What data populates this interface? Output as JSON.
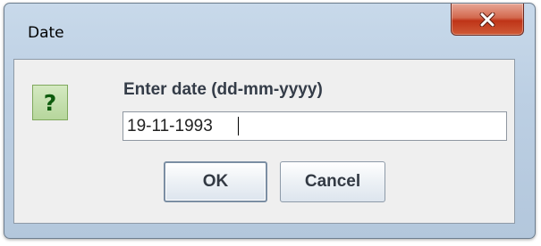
{
  "window": {
    "title": "Date",
    "close_icon": "close-x-icon"
  },
  "dialog": {
    "icon": "question-icon",
    "icon_glyph": "?",
    "prompt": "Enter date (dd-mm-yyyy)",
    "input_value": "19-11-1993"
  },
  "buttons": {
    "ok_label": "OK",
    "cancel_label": "Cancel"
  }
}
